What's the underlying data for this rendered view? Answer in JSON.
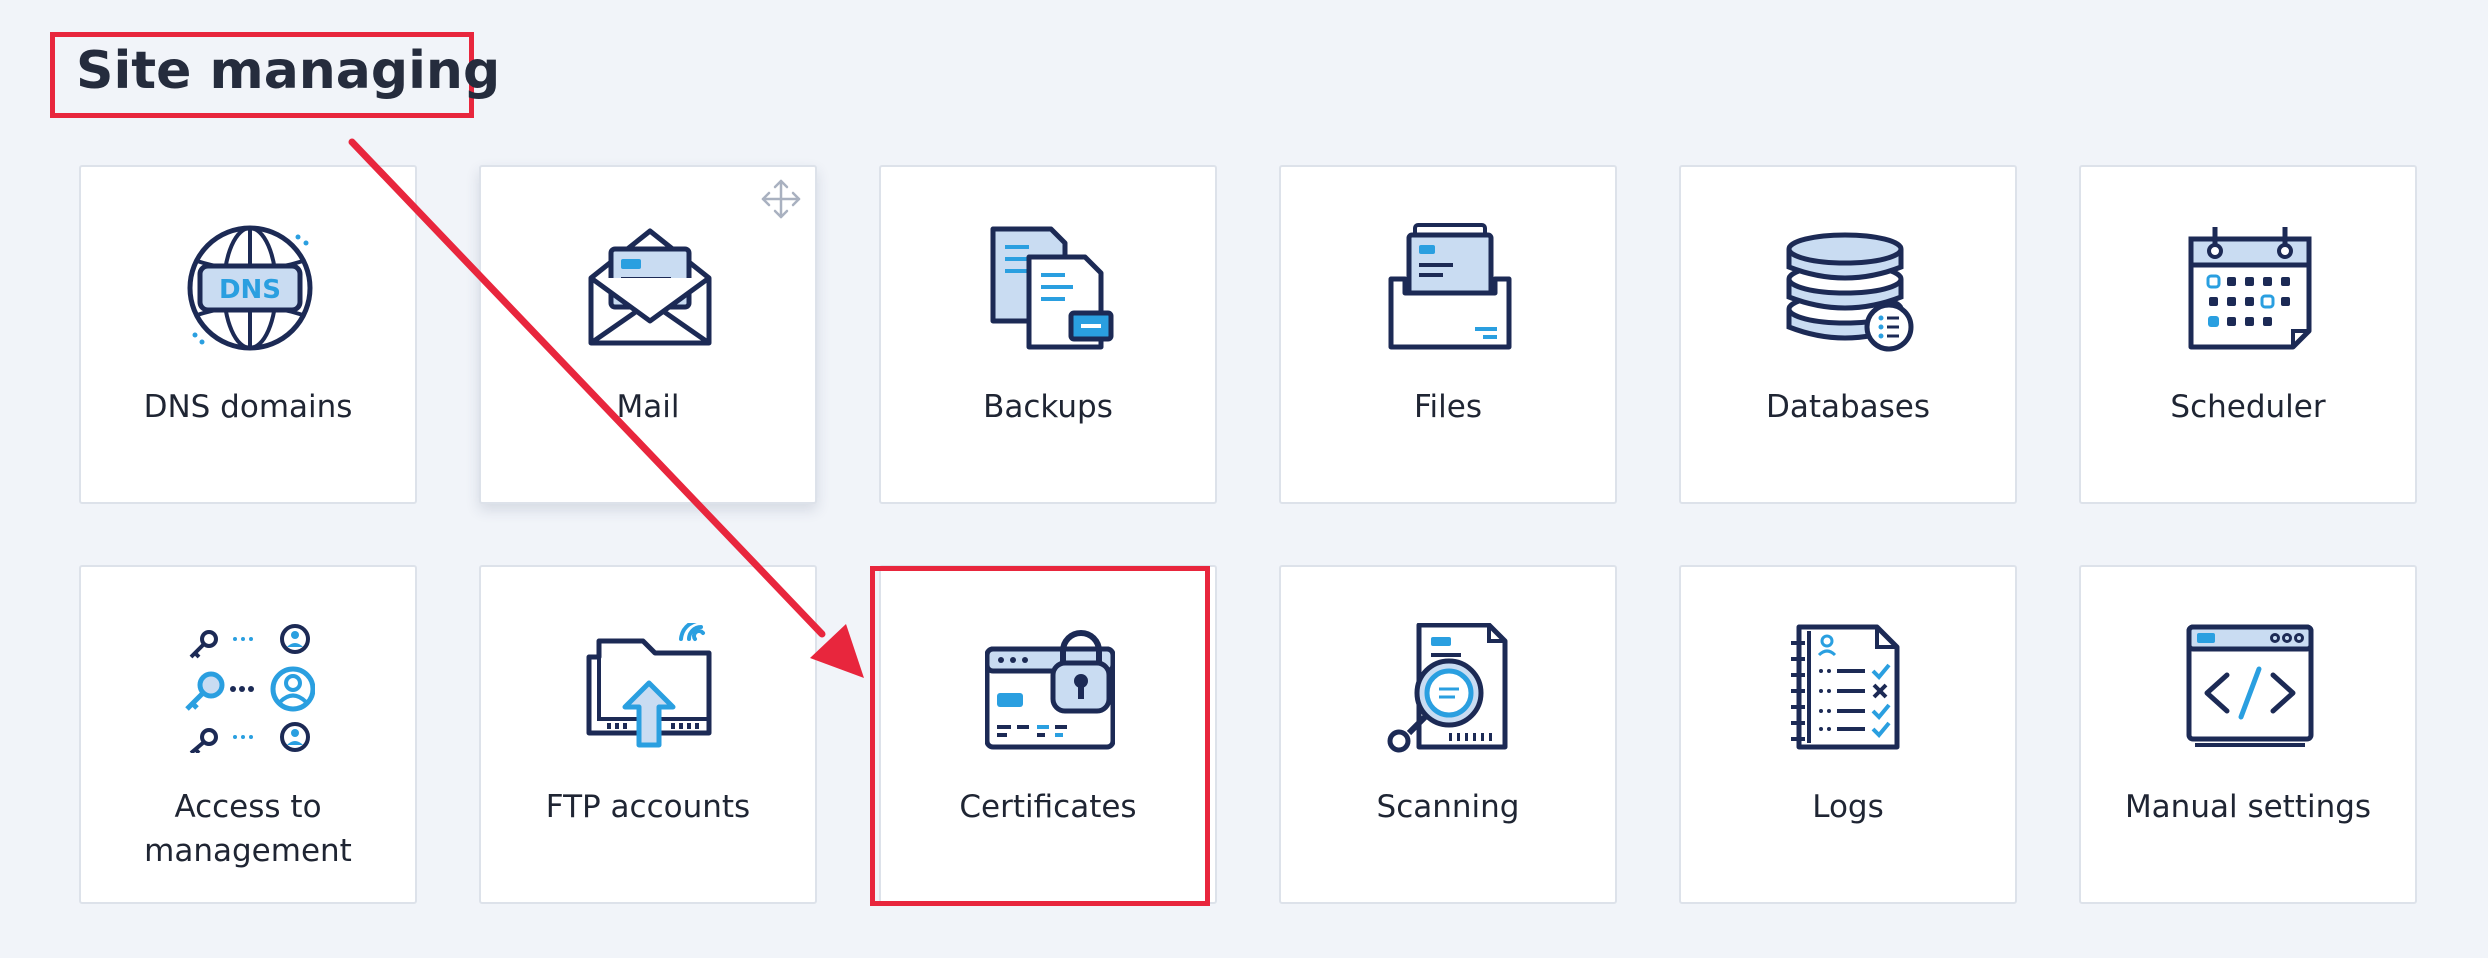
{
  "page": {
    "title": "Site managing"
  },
  "colors": {
    "background": "#f1f4f9",
    "tile_background": "#ffffff",
    "icon_navy": "#1c2a55",
    "icon_blue": "#2a9fe0",
    "icon_fill": "#c9dcf2",
    "annotation_red": "#e8263d"
  },
  "tiles": [
    {
      "label": "DNS domains",
      "icon": "dns-globe-icon",
      "dns_text": "DNS"
    },
    {
      "label": "Mail",
      "icon": "mail-envelope-icon"
    },
    {
      "label": "Backups",
      "icon": "backup-documents-icon"
    },
    {
      "label": "Files",
      "icon": "folder-files-icon"
    },
    {
      "label": "Databases",
      "icon": "database-icon"
    },
    {
      "label": "Scheduler",
      "icon": "calendar-icon"
    },
    {
      "label": "Access to management",
      "icon": "access-keys-users-icon"
    },
    {
      "label": "FTP accounts",
      "icon": "ftp-upload-folder-icon"
    },
    {
      "label": "Certificates",
      "icon": "certificate-lock-icon"
    },
    {
      "label": "Scanning",
      "icon": "document-magnifier-icon"
    },
    {
      "label": "Logs",
      "icon": "log-notebook-icon"
    },
    {
      "label": "Manual settings",
      "icon": "code-window-icon"
    }
  ],
  "annotations": {
    "highlighted_tile": "Certificates",
    "drag_handle_icon": "move-arrows-icon"
  }
}
